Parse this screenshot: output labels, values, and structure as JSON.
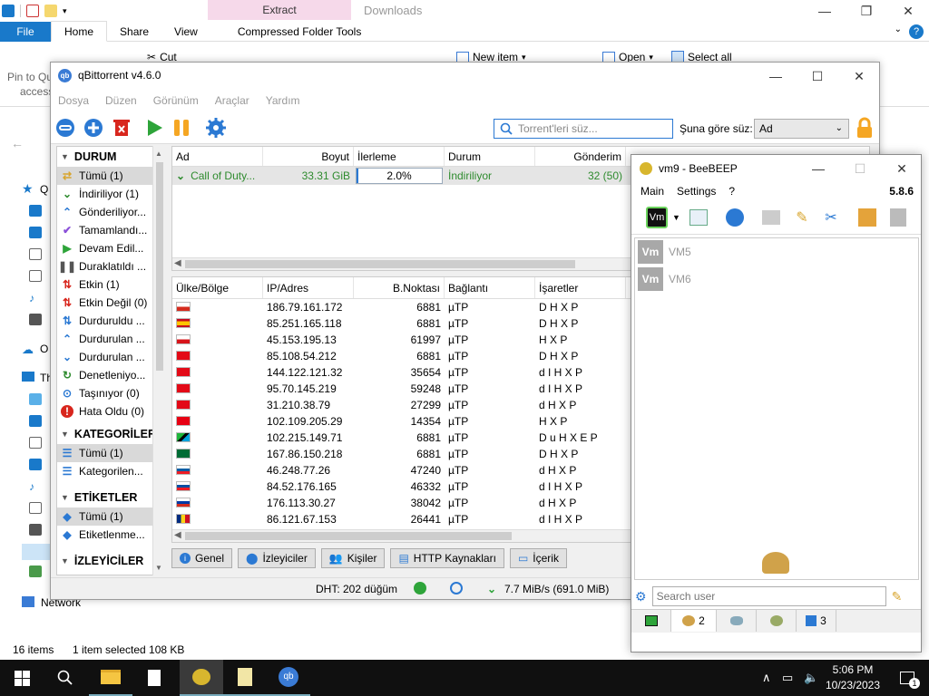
{
  "explorer": {
    "context_tab": "Extract",
    "title": "Downloads",
    "tabs": [
      "File",
      "Home",
      "Share",
      "View",
      "Compressed Folder Tools"
    ],
    "ribbon": {
      "cut": "Cut",
      "new_item": "New item",
      "open": "Open",
      "select_all": "Select all",
      "pin": "Pin to Qu",
      "access": "access"
    },
    "nav": {
      "network": "Network",
      "this_pc": "Th",
      "onedrive": "O",
      "quick": "Q"
    },
    "status": {
      "items": "16 items",
      "selected": "1 item selected  108 KB"
    }
  },
  "qbt": {
    "title": "qBittorrent v4.6.0",
    "menu": [
      "Dosya",
      "Düzen",
      "Görünüm",
      "Araçlar",
      "Yardım"
    ],
    "search_placeholder": "Torrent'leri süz...",
    "filter_label": "Şuna göre süz:",
    "filter_value": "Ad",
    "sidebar": {
      "status_header": "DURUM",
      "status_items": [
        {
          "label": "Tümü (1)",
          "icon": "all-icon"
        },
        {
          "label": "İndiriliyor (1)",
          "icon": "downloading-icon"
        },
        {
          "label": "Gönderiliyor...",
          "icon": "seeding-icon"
        },
        {
          "label": "Tamamlandı...",
          "icon": "completed-icon"
        },
        {
          "label": "Devam Edil...",
          "icon": "resumed-icon"
        },
        {
          "label": "Duraklatıldı ...",
          "icon": "paused-icon"
        },
        {
          "label": "Etkin (1)",
          "icon": "active-icon"
        },
        {
          "label": "Etkin Değil (0)",
          "icon": "inactive-icon"
        },
        {
          "label": "Durduruldu ...",
          "icon": "stalled-icon"
        },
        {
          "label": "Durdurulan ...",
          "icon": "stalled-up-icon"
        },
        {
          "label": "Durdurulan ...",
          "icon": "stalled-down-icon"
        },
        {
          "label": "Denetleniyo...",
          "icon": "checking-icon"
        },
        {
          "label": "Taşınıyor (0)",
          "icon": "moving-icon"
        },
        {
          "label": "Hata Oldu (0)",
          "icon": "error-icon"
        }
      ],
      "categories_header": "KATEGORİLER",
      "category_items": [
        "Tümü (1)",
        "Kategorilen..."
      ],
      "tags_header": "ETİKETLER",
      "tag_items": [
        "Tümü (1)",
        "Etiketlenme..."
      ],
      "trackers_header": "İZLEYİCİLER"
    },
    "torrent_columns": [
      "Ad",
      "Boyut",
      "İlerleme",
      "Durum",
      "Gönderim"
    ],
    "torrent": {
      "name": "Call of Duty...",
      "size": "33.31 GiB",
      "progress": "2.0%",
      "progress_value": 0.02,
      "status": "İndiriliyor",
      "seeds": "32 (50)"
    },
    "peer_columns": [
      "Ülke/Bölge",
      "IP/Adres",
      "B.Noktası",
      "Bağlantı",
      "İşaretler"
    ],
    "peers": [
      {
        "flag": "cl",
        "ip": "186.79.161.172",
        "port": "6881",
        "conn": "µTP",
        "flags": "D H X P"
      },
      {
        "flag": "es",
        "ip": "85.251.165.118",
        "port": "6881",
        "conn": "µTP",
        "flags": "D H X P"
      },
      {
        "flag": "cz",
        "ip": "45.153.195.13",
        "port": "61997",
        "conn": "µTP",
        "flags": "H X P"
      },
      {
        "flag": "tr",
        "ip": "85.108.54.212",
        "port": "6881",
        "conn": "µTP",
        "flags": "D H X P"
      },
      {
        "flag": "tr",
        "ip": "144.122.121.32",
        "port": "35654",
        "conn": "µTP",
        "flags": "d I H X P"
      },
      {
        "flag": "tr",
        "ip": "95.70.145.219",
        "port": "59248",
        "conn": "µTP",
        "flags": "d I H X P"
      },
      {
        "flag": "tr",
        "ip": "31.210.38.79",
        "port": "27299",
        "conn": "µTP",
        "flags": "d H X P"
      },
      {
        "flag": "tn",
        "ip": "102.109.205.29",
        "port": "14354",
        "conn": "µTP",
        "flags": "H X P"
      },
      {
        "flag": "tz",
        "ip": "102.215.149.71",
        "port": "6881",
        "conn": "µTP",
        "flags": "D u H X E P"
      },
      {
        "flag": "sa",
        "ip": "167.86.150.218",
        "port": "6881",
        "conn": "µTP",
        "flags": "D H X P"
      },
      {
        "flag": "si",
        "ip": "46.248.77.26",
        "port": "47240",
        "conn": "µTP",
        "flags": "d H X P"
      },
      {
        "flag": "sk",
        "ip": "84.52.176.165",
        "port": "46332",
        "conn": "µTP",
        "flags": "d I H X P"
      },
      {
        "flag": "ru",
        "ip": "176.113.30.27",
        "port": "38042",
        "conn": "µTP",
        "flags": "d H X P"
      },
      {
        "flag": "ro",
        "ip": "86.121.67.153",
        "port": "26441",
        "conn": "µTP",
        "flags": "d I H X P"
      }
    ],
    "bottom_tabs": [
      "Genel",
      "İzleyiciler",
      "Kişiler",
      "HTTP Kaynakları",
      "İçerik"
    ],
    "status": {
      "dht": "DHT: 202 düğüm",
      "speed": "7.7 MiB/s (691.0 MiB)"
    }
  },
  "beebeep": {
    "title": "vm9 - BeeBEEP",
    "menu": [
      "Main",
      "Settings",
      "?"
    ],
    "version": "5.8.6",
    "users": [
      {
        "avatar": "Vm",
        "name": "VM5"
      },
      {
        "avatar": "Vm",
        "name": "VM6"
      }
    ],
    "search_placeholder": "Search user",
    "tabs": [
      {
        "label": "",
        "icon": "chat-icon"
      },
      {
        "label": "2",
        "icon": "users-icon"
      },
      {
        "label": "",
        "icon": "messages-icon"
      },
      {
        "label": "",
        "icon": "groups-icon"
      },
      {
        "label": "3",
        "icon": "shares-icon"
      }
    ]
  },
  "taskbar": {
    "time": "5:06 PM",
    "date": "10/23/2023",
    "notif": "1"
  },
  "colors": {
    "accent": "#1979ca",
    "green": "#2e8b2e",
    "orange": "#f5a623",
    "red": "#d8261d"
  }
}
